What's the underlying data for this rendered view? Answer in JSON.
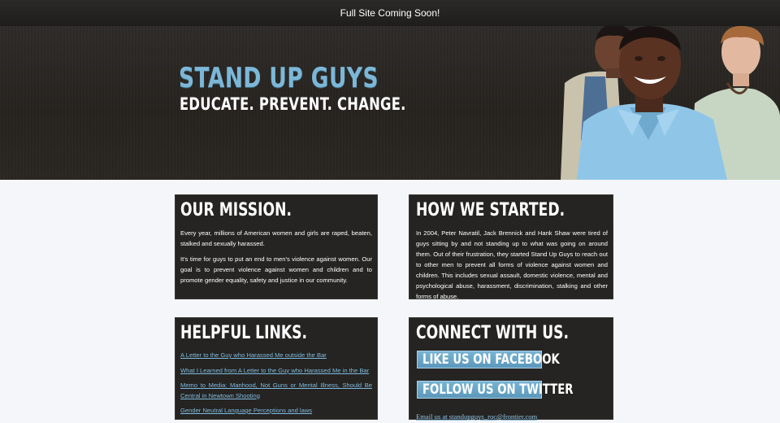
{
  "topbar": {
    "notice": "Full Site Coming Soon!"
  },
  "hero": {
    "title": "STAND UP GUYS",
    "tagline": "EDUCATE. PREVENT. CHANGE.",
    "title_color": "#7cb7d8"
  },
  "mission": {
    "heading": "OUR MISSION.",
    "paragraphs": [
      "Every year, millions of American women and girls are raped, beaten, stalked and sexually harassed.",
      "It's time for guys to put an end to men's violence against women. Our goal is to prevent violence against women and children and to promote gender equality, safety and justice in our community."
    ]
  },
  "started": {
    "heading": "HOW WE STARTED.",
    "paragraphs": [
      "In 2004, Peter Navratil, Jack Brennick and Hank Shaw were tired of guys sitting by and not standing up to what was going on around them. Out of their frustration, they started Stand Up Guys to reach out to other men to prevent all forms of violence against women and children. This includes sexual assault, domestic violence, mental and psychological abuse, harassment, discrimination, stalking and other forms of abuse."
    ]
  },
  "links": {
    "heading": "HELPFUL LINKS.",
    "items": [
      "A Letter to the Guy who Harassed Me outside the Bar",
      "What I Learned from A Letter to the Guy who Harassed Me in the Bar",
      "Memo to Media: Manhood, Not Guns or Mental Illness, Should Be Central in Newtown Shooting",
      "Gender Neutral Language Perceptions and laws"
    ],
    "link_color": "#7fb9dd"
  },
  "connect": {
    "heading": "CONNECT WITH US.",
    "facebook_label": "LIKE US ON FACEBOOK",
    "twitter_label": "FOLLOW US ON TWITTER",
    "email_label": "Email us at standupguys_roc@frontier.com",
    "button_color": "#6aa7c9"
  }
}
